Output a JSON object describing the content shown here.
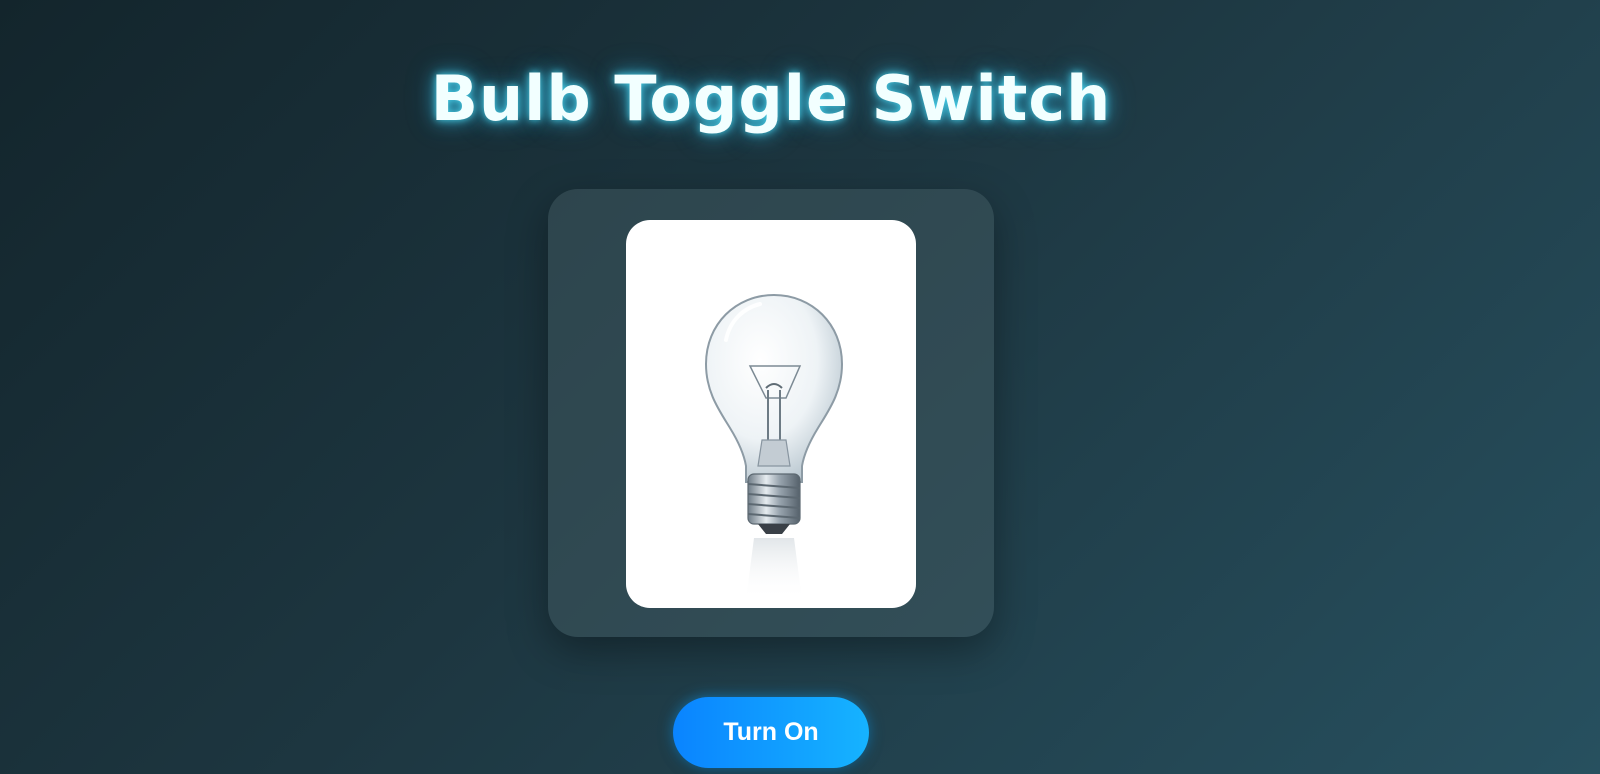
{
  "header": {
    "title": "Bulb Toggle Switch"
  },
  "bulb": {
    "state": "off",
    "image_icon": "light-bulb-icon"
  },
  "toggle": {
    "label": "Turn On"
  },
  "colors": {
    "title_glow": "#50e6ff",
    "button_start": "#0a84ff",
    "button_end": "#16b3ff",
    "background_dark": "#13252c",
    "background_light": "#27505f"
  }
}
